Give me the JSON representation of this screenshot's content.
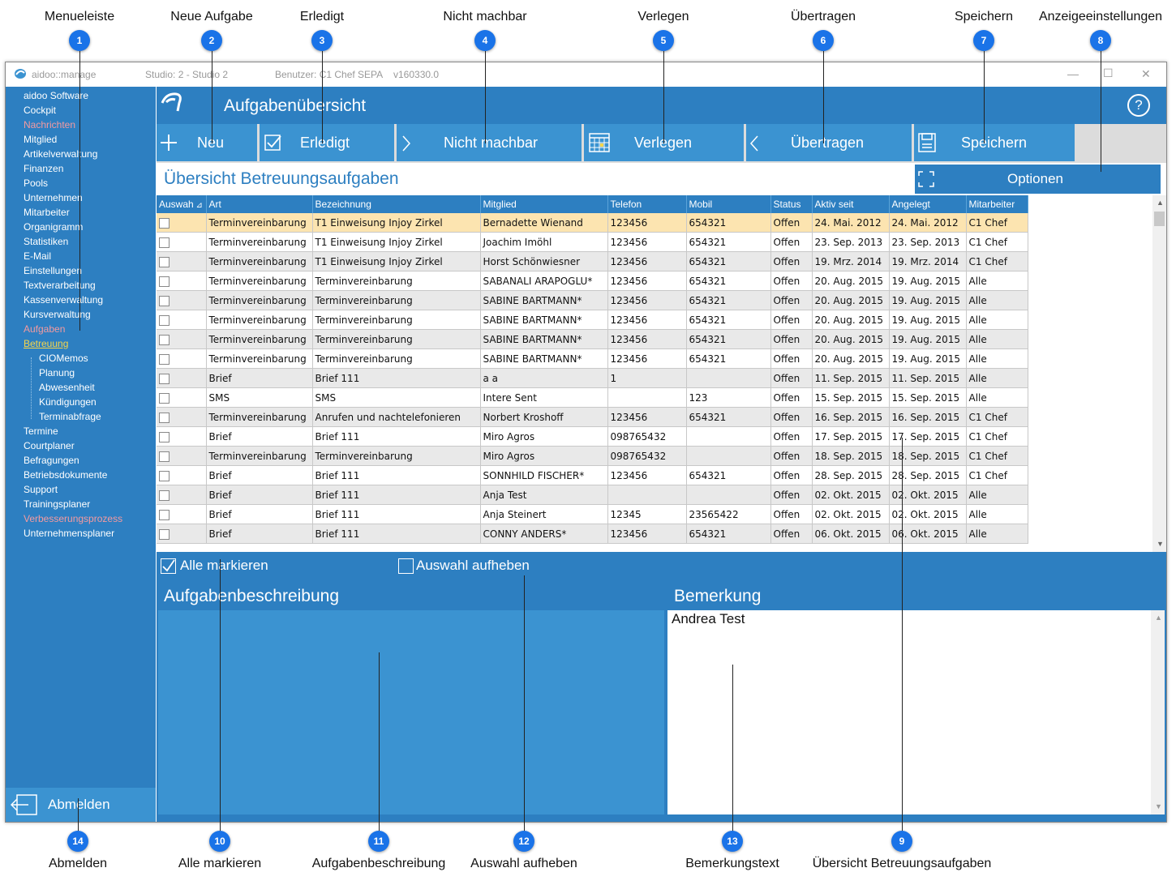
{
  "annotations": {
    "top": [
      {
        "num": "1",
        "label": "Menueleiste"
      },
      {
        "num": "2",
        "label": "Neue Aufgabe"
      },
      {
        "num": "3",
        "label": "Erledigt"
      },
      {
        "num": "4",
        "label": "Nicht machbar"
      },
      {
        "num": "5",
        "label": "Verlegen"
      },
      {
        "num": "6",
        "label": "Übertragen"
      },
      {
        "num": "7",
        "label": "Speichern"
      },
      {
        "num": "8",
        "label": "Anzeigeeinstellungen"
      }
    ],
    "bottom": [
      {
        "num": "14",
        "label": "Abmelden"
      },
      {
        "num": "10",
        "label": "Alle markieren"
      },
      {
        "num": "11",
        "label": "Aufgabenbeschreibung"
      },
      {
        "num": "12",
        "label": "Auswahl aufheben"
      },
      {
        "num": "13",
        "label": "Bemerkungstext"
      },
      {
        "num": "9",
        "label": "Übersicht Betreuungsaufgaben"
      }
    ]
  },
  "titlebar": {
    "app": "aidoo::manage",
    "studio": "Studio: 2 - Studio 2",
    "user": "Benutzer: C1 Chef   SEPA",
    "version": "v160330.0",
    "minimize": "—",
    "maximize": "☐",
    "close": "✕"
  },
  "sidebar": {
    "items": [
      {
        "label": "aidoo Software",
        "style": "normal"
      },
      {
        "label": "Cockpit",
        "style": "normal"
      },
      {
        "label": "Nachrichten",
        "style": "red"
      },
      {
        "label": "Mitglied",
        "style": "normal"
      },
      {
        "label": "Artikelverwaltung",
        "style": "normal"
      },
      {
        "label": "Finanzen",
        "style": "normal"
      },
      {
        "label": "Pools",
        "style": "normal"
      },
      {
        "label": "Unternehmen",
        "style": "normal"
      },
      {
        "label": "Mitarbeiter",
        "style": "normal"
      },
      {
        "label": "Organigramm",
        "style": "normal"
      },
      {
        "label": "Statistiken",
        "style": "normal"
      },
      {
        "label": "E-Mail",
        "style": "normal"
      },
      {
        "label": "Einstellungen",
        "style": "normal"
      },
      {
        "label": "Textverarbeitung",
        "style": "normal"
      },
      {
        "label": "Kassenverwaltung",
        "style": "normal"
      },
      {
        "label": "Kursverwaltung",
        "style": "normal"
      },
      {
        "label": "Aufgaben",
        "style": "red"
      },
      {
        "label": "Betreuung",
        "style": "active"
      },
      {
        "label": "CIOMemos",
        "style": "sub"
      },
      {
        "label": "Planung",
        "style": "sub"
      },
      {
        "label": "Abwesenheit",
        "style": "sub"
      },
      {
        "label": "Kündigungen",
        "style": "sub"
      },
      {
        "label": "Terminabfrage",
        "style": "sub"
      },
      {
        "label": "Termine",
        "style": "normal"
      },
      {
        "label": "Courtplaner",
        "style": "normal"
      },
      {
        "label": "Befragungen",
        "style": "normal"
      },
      {
        "label": "Betriebsdokumente",
        "style": "normal"
      },
      {
        "label": "Support",
        "style": "normal"
      },
      {
        "label": "Trainingsplaner",
        "style": "normal"
      },
      {
        "label": "Verbesserungsprozess",
        "style": "red"
      },
      {
        "label": "Unternehmensplaner",
        "style": "normal"
      }
    ],
    "logout_label": "Abmelden"
  },
  "header": {
    "title": "Aufgabenübersicht",
    "help": "?"
  },
  "toolbar": {
    "neu": "Neu",
    "erledigt": "Erledigt",
    "nicht_machbar": "Nicht machbar",
    "verlegen": "Verlegen",
    "uebertragen": "Übertragen",
    "speichern": "Speichern",
    "optionen": "Optionen"
  },
  "subtitle": "Übersicht Betreuungsaufgaben",
  "table": {
    "columns": [
      "Auswah",
      "Art",
      "Bezeichnung",
      "Mitglied",
      "Telefon",
      "Mobil",
      "Status",
      "Aktiv seit",
      "Angelegt",
      "Mitarbeiter"
    ],
    "rows": [
      [
        "Terminvereinbarung",
        "T1 Einweisung Injoy Zirkel",
        "Bernadette Wienand",
        "123456",
        "654321",
        "Offen",
        "24. Mai. 2012",
        "24. Mai. 2012",
        "C1 Chef"
      ],
      [
        "Terminvereinbarung",
        "T1 Einweisung Injoy Zirkel",
        "Joachim Imöhl",
        "123456",
        "654321",
        "Offen",
        "23. Sep. 2013",
        "23. Sep. 2013",
        "C1 Chef"
      ],
      [
        "Terminvereinbarung",
        "T1 Einweisung Injoy Zirkel",
        "Horst Schönwiesner",
        "123456",
        "654321",
        "Offen",
        "19. Mrz. 2014",
        "19. Mrz. 2014",
        "C1 Chef"
      ],
      [
        "Terminvereinbarung",
        "Terminvereinbarung",
        "SABANALI ARAPOGLU*",
        "123456",
        "654321",
        "Offen",
        "20. Aug. 2015",
        "19. Aug. 2015",
        "Alle"
      ],
      [
        "Terminvereinbarung",
        "Terminvereinbarung",
        "SABINE BARTMANN*",
        "123456",
        "654321",
        "Offen",
        "20. Aug. 2015",
        "19. Aug. 2015",
        "Alle"
      ],
      [
        "Terminvereinbarung",
        "Terminvereinbarung",
        "SABINE BARTMANN*",
        "123456",
        "654321",
        "Offen",
        "20. Aug. 2015",
        "19. Aug. 2015",
        "Alle"
      ],
      [
        "Terminvereinbarung",
        "Terminvereinbarung",
        "SABINE BARTMANN*",
        "123456",
        "654321",
        "Offen",
        "20. Aug. 2015",
        "19. Aug. 2015",
        "Alle"
      ],
      [
        "Terminvereinbarung",
        "Terminvereinbarung",
        "SABINE BARTMANN*",
        "123456",
        "654321",
        "Offen",
        "20. Aug. 2015",
        "19. Aug. 2015",
        "Alle"
      ],
      [
        "Brief",
        "Brief 111",
        "a a",
        "1",
        "",
        "Offen",
        "11. Sep. 2015",
        "11. Sep. 2015",
        "Alle"
      ],
      [
        "SMS",
        "SMS",
        "Intere Sent",
        "",
        "123",
        "Offen",
        "15. Sep. 2015",
        "15. Sep. 2015",
        "Alle"
      ],
      [
        "Terminvereinbarung",
        "Anrufen und nachtelefonieren",
        "Norbert  Kroshoff",
        "123456",
        "654321",
        "Offen",
        "16. Sep. 2015",
        "16. Sep. 2015",
        "C1 Chef"
      ],
      [
        "Brief",
        "Brief 111",
        "Miro Agros",
        "098765432",
        "",
        "Offen",
        "17. Sep. 2015",
        "17. Sep. 2015",
        "C1 Chef"
      ],
      [
        "Terminvereinbarung",
        "Terminvereinbarung",
        "Miro Agros",
        "098765432",
        "",
        "Offen",
        "18. Sep. 2015",
        "18. Sep. 2015",
        "C1 Chef"
      ],
      [
        "Brief",
        "Brief 111",
        "SONNHILD FISCHER*",
        "123456",
        "654321",
        "Offen",
        "28. Sep. 2015",
        "28. Sep. 2015",
        "C1 Chef"
      ],
      [
        "Brief",
        "Brief 111",
        "Anja Test",
        "",
        "",
        "Offen",
        "02. Okt. 2015",
        "02. Okt. 2015",
        "Alle"
      ],
      [
        "Brief",
        "Brief 111",
        "Anja Steinert",
        "12345",
        "23565422",
        "Offen",
        "02. Okt. 2015",
        "02. Okt. 2015",
        "Alle"
      ],
      [
        "Brief",
        "Brief 111",
        "CONNY ANDERS*",
        "123456",
        "654321",
        "Offen",
        "06. Okt. 2015",
        "06. Okt. 2015",
        "Alle"
      ]
    ]
  },
  "markbar": {
    "alle_markieren": "Alle markieren",
    "auswahl_aufheben": "Auswahl aufheben"
  },
  "description": {
    "title": "Aufgabenbeschreibung",
    "text": ""
  },
  "remark": {
    "title": "Bemerkung",
    "text": "Andrea Test"
  },
  "colors": {
    "primary": "#2d7fc1",
    "button": "#3b93d1",
    "selected_row": "#fce4b0",
    "red_menu": "#f49aa0",
    "active_menu": "#f5d54a",
    "badge": "#1a73e8"
  }
}
